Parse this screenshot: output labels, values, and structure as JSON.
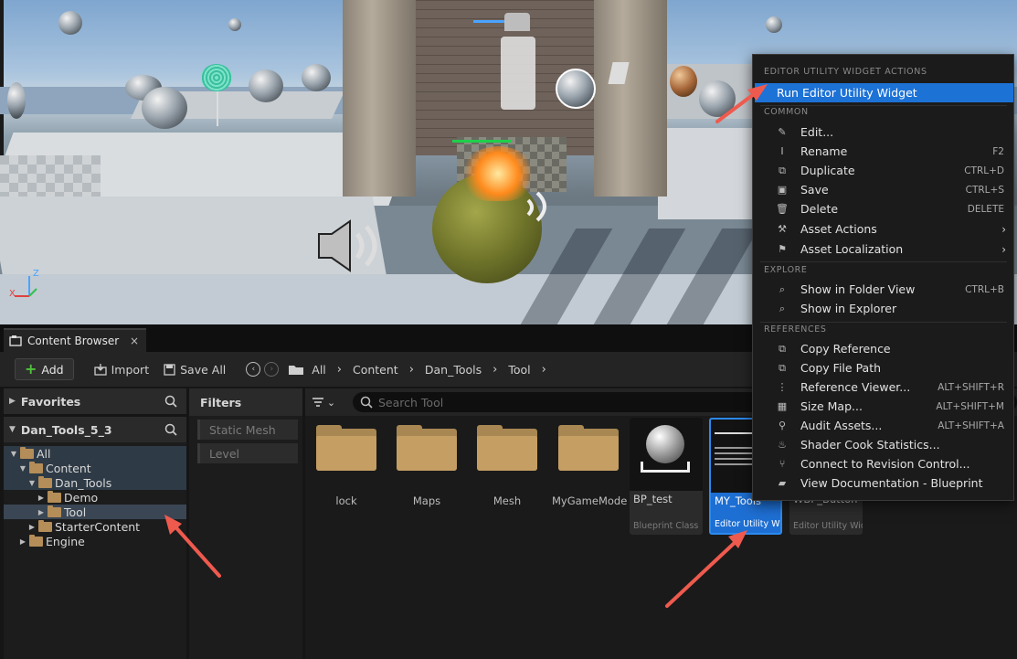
{
  "content_browser": {
    "tab_label": "Content Browser",
    "tab_close": "×",
    "toolbar": {
      "add_label": "Add",
      "import_label": "Import",
      "save_all_label": "Save All"
    },
    "breadcrumbs": [
      "All",
      "Content",
      "Dan_Tools",
      "Tool"
    ],
    "favorites_label": "Favorites",
    "project_label": "Dan_Tools_5_3",
    "tree": [
      "All",
      "Content",
      "Dan_Tools",
      "Demo",
      "Tool",
      "StarterContent",
      "Engine"
    ],
    "filters_label": "Filters",
    "filter_chips": [
      "Static Mesh",
      "Level"
    ],
    "search_placeholder": "Search Tool",
    "folders": [
      "lock",
      "Maps",
      "Mesh",
      "MyGameMode"
    ],
    "assets": [
      {
        "name": "BP_test",
        "type": "Blueprint Class"
      },
      {
        "name": "MY_Tools",
        "type": "Editor Utility Wid..."
      },
      {
        "name": "WBP_Button",
        "type": "Editor Utility Wid..."
      }
    ]
  },
  "context_menu": {
    "headers": {
      "widget_actions": "EDITOR UTILITY WIDGET ACTIONS",
      "common": "COMMON",
      "explore": "EXPLORE",
      "references": "REFERENCES"
    },
    "run_item": "Run Editor Utility Widget",
    "common_items": [
      {
        "label": "Edit...",
        "shortcut": ""
      },
      {
        "label": "Rename",
        "shortcut": "F2"
      },
      {
        "label": "Duplicate",
        "shortcut": "CTRL+D"
      },
      {
        "label": "Save",
        "shortcut": "CTRL+S"
      },
      {
        "label": "Delete",
        "shortcut": "DELETE"
      },
      {
        "label": "Asset Actions",
        "shortcut": ""
      },
      {
        "label": "Asset Localization",
        "shortcut": ""
      }
    ],
    "explore_items": [
      {
        "label": "Show in Folder View",
        "shortcut": "CTRL+B"
      },
      {
        "label": "Show in Explorer",
        "shortcut": ""
      }
    ],
    "reference_items": [
      {
        "label": "Copy Reference",
        "shortcut": ""
      },
      {
        "label": "Copy File Path",
        "shortcut": ""
      },
      {
        "label": "Reference Viewer...",
        "shortcut": "ALT+SHIFT+R"
      },
      {
        "label": "Size Map...",
        "shortcut": "ALT+SHIFT+M"
      },
      {
        "label": "Audit Assets...",
        "shortcut": "ALT+SHIFT+A"
      },
      {
        "label": "Shader Cook Statistics...",
        "shortcut": ""
      },
      {
        "label": "Connect to Revision Control...",
        "shortcut": ""
      },
      {
        "label": "View Documentation - Blueprint",
        "shortcut": ""
      }
    ],
    "submenu_arrow": "›"
  },
  "viewport": {
    "axis_labels": [
      "Z",
      "X"
    ]
  },
  "colors": {
    "accent": "#1d72d6",
    "annotation_arrow": "#ef5a4e",
    "folder": "#c49e63"
  }
}
